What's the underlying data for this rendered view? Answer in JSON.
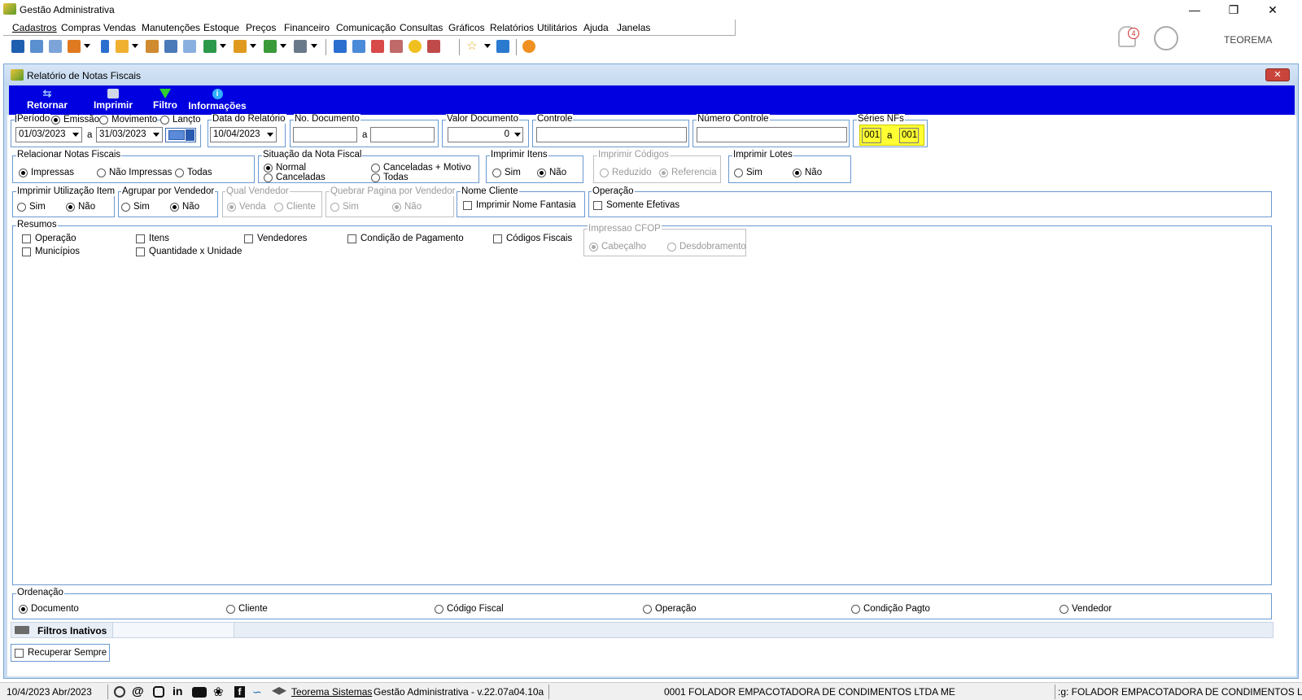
{
  "app": {
    "title": "Gestão Administrativa",
    "window_buttons": [
      "minimize",
      "restore",
      "close"
    ]
  },
  "menu": [
    "Cadastros",
    "Compras",
    "Vendas",
    "Manutenções",
    "Estoque",
    "Preços",
    "Financeiro",
    "Comunicação",
    "Consultas",
    "Gráficos",
    "Relatórios",
    "Utilitários",
    "Ajuda",
    "Janelas"
  ],
  "user": {
    "notification_count": "4",
    "name": "TEOREMA"
  },
  "window": {
    "title": "Relatório de Notas Fiscais",
    "close_label": "✕"
  },
  "actions": [
    {
      "label": "Retornar",
      "icon": "back-arrow-icon"
    },
    {
      "label": "Imprimir",
      "icon": "printer-icon"
    },
    {
      "label": "Filtro",
      "icon": "funnel-icon"
    },
    {
      "label": "Informações",
      "icon": "info-icon"
    }
  ],
  "periodo": {
    "legend": "Período",
    "options": [
      "Emissão",
      "Movimento",
      "Lançto"
    ],
    "selected": "Emissão",
    "from": "01/03/2023",
    "sep": "a",
    "to": "31/03/2023"
  },
  "data_relatorio": {
    "legend": "Data do Relatório",
    "value": "10/04/2023"
  },
  "no_documento": {
    "legend": "No. Documento",
    "from": "",
    "sep": "a",
    "to": ""
  },
  "valor_documento": {
    "legend": "Valor Documento",
    "value": "0"
  },
  "controle": {
    "legend": "Controle",
    "value": ""
  },
  "numero_controle": {
    "legend": "Número Controle",
    "value": ""
  },
  "series": {
    "legend": "Séries NFs",
    "from": "001",
    "sep": "a",
    "to": "001"
  },
  "relacionar": {
    "legend": "Relacionar Notas Fiscais",
    "options": [
      "Impressas",
      "Não Impressas",
      "Todas"
    ],
    "selected": "Impressas"
  },
  "situacao": {
    "legend": "Situação da Nota Fiscal",
    "options": [
      "Normal",
      "Canceladas + Motivo",
      "Canceladas",
      "Todas"
    ],
    "selected": "Normal"
  },
  "imprimir_itens": {
    "legend": "Imprimir Itens",
    "options": [
      "Sim",
      "Não"
    ],
    "selected": "Não"
  },
  "imprimir_codigos": {
    "legend": "Imprimir Códigos",
    "options": [
      "Reduzido",
      "Referencia"
    ],
    "selected": "Referencia"
  },
  "imprimir_lotes": {
    "legend": "Imprimir Lotes",
    "options": [
      "Sim",
      "Não"
    ],
    "selected": "Não"
  },
  "imprimir_utilizacao": {
    "legend": "Imprimir Utilização Item",
    "options": [
      "Sim",
      "Não"
    ],
    "selected": "Não"
  },
  "agrupar_vendedor": {
    "legend": "Agrupar por Vendedor",
    "options": [
      "Sim",
      "Não"
    ],
    "selected": "Não"
  },
  "qual_vendedor": {
    "legend": "Qual Vendedor",
    "options": [
      "Venda",
      "Cliente"
    ],
    "selected": "Venda"
  },
  "quebrar_pagina": {
    "legend": "Quebrar Pagina por Vendedor",
    "options": [
      "Sim",
      "Não"
    ],
    "selected": "Não"
  },
  "nome_cliente": {
    "legend": "Nome Cliente",
    "check": "Imprimir Nome Fantasia"
  },
  "operacao": {
    "legend": "Operação",
    "check": "Somente Efetivas"
  },
  "resumos": {
    "legend": "Resumos",
    "checks": [
      "Operação",
      "Municípios",
      "Itens",
      "Quantidade x Unidade",
      "Vendedores",
      "Condição de Pagamento",
      "Códigos Fiscais"
    ]
  },
  "impressao_cfop": {
    "legend": "Impressao CFOP",
    "options": [
      "Cabeçalho",
      "Desdobramento"
    ],
    "selected": "Cabeçalho"
  },
  "ordenacao": {
    "legend": "Ordenação",
    "options": [
      "Documento",
      "Cliente",
      "Código Fiscal",
      "Operação",
      "Condição Pagto",
      "Vendedor"
    ],
    "selected": "Documento"
  },
  "filtros_inativos": "Filtros Inativos",
  "recuperar_sempre": "Recuperar Sempre",
  "status": {
    "date": "10/4/2023 Abr/2023",
    "company_link": "Teorema Sistemas",
    "version": "Gestão Administrativa - v.22.07a04.10a",
    "company": "0001 FOLADOR EMPACOTADORA DE CONDIMENTOS LTDA ME",
    "right": ":g: FOLADOR EMPACOTADORA DE CONDIMENTOS LTDA"
  },
  "colors": {
    "action_bar": "#0000e0",
    "highlight": "#ffff33",
    "group_border": "#6a9ad0"
  }
}
